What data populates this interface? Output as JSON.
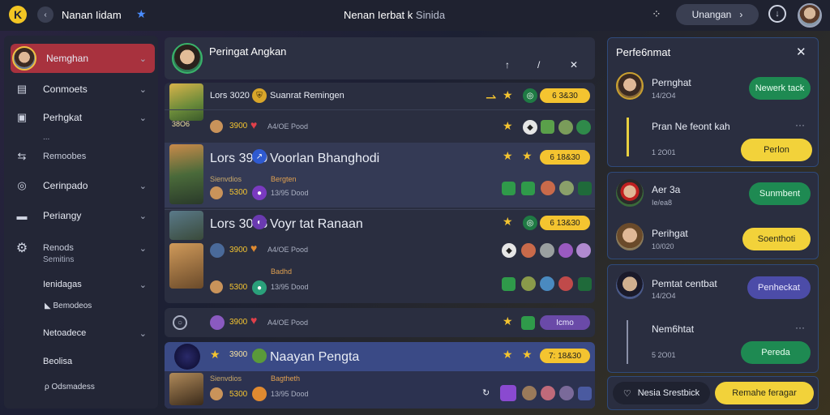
{
  "topbar": {
    "logo_glyph": "K",
    "back_glyph": "‹",
    "username": "Nanan Iidam",
    "star_glyph": "★",
    "title_main": "Nenan Ierbat k",
    "title_sub": "Sinida",
    "grid_glyph": "⁘",
    "search_label": "Unangan",
    "search_glyph": "›",
    "download_glyph": "↓"
  },
  "sidebar": {
    "items": [
      {
        "label": "Nemghan",
        "icon": "avatar",
        "active": true
      },
      {
        "label": "Conmoets",
        "icon": "layout-icon"
      },
      {
        "label": "Perhgkat",
        "icon": "lock-icon"
      },
      {
        "label": "Remoobes",
        "icon": "share-icon"
      },
      {
        "label": "Cerinpado",
        "icon": "target-icon"
      },
      {
        "label": "Periangy",
        "icon": "wallet-icon"
      },
      {
        "label": "Renods",
        "icon": "gear-icon"
      },
      {
        "label": "Ienidagas"
      },
      {
        "label": "Netoadece"
      },
      {
        "label": "Beolisa"
      }
    ],
    "sub_lines": [
      "...",
      "Semitins",
      "Bemodeos",
      "Odsmadess"
    ]
  },
  "main": {
    "header_title": "Peringat Angkan",
    "header_actions": [
      "↑",
      "/",
      "✕"
    ],
    "rows": [
      {
        "code": "Lors 3020",
        "name": "Suanrat Remingen",
        "pill": "6 3&30",
        "line2": "3900",
        "line2b": "A4/OE Pood",
        "badge": "38O6"
      },
      {
        "code": "Lors 3900",
        "name": "Voorlan Bhanghodi",
        "pill": "6 18&30",
        "line2": "5300",
        "line2b": "13/95 Dood",
        "sub_a": "Sienvdios",
        "sub_b": "Bergten"
      },
      {
        "code": "Lors 3036",
        "name": "Voyr tat Ranaan",
        "pill": "6 13&30",
        "line2": "3900",
        "line2b": "A4/OE Pood"
      },
      {
        "code": "",
        "name": "",
        "pill": "",
        "line2": "5300",
        "line2b": "13/95 Dood",
        "sub_a": "Sienvdios",
        "sub_b": "Badhd"
      },
      {
        "code": "",
        "name": "",
        "pill": "Icmo",
        "line2": "3900",
        "line2b": "A4/OE Pood"
      },
      {
        "code": "3900",
        "name": "Naayan Pengta",
        "pill": "7: 18&30",
        "line2": "5300",
        "line2b": "13/95 Dood",
        "sub_a": "Sienvdios",
        "sub_b": "Bagtheth"
      }
    ]
  },
  "right": {
    "title": "Perfe6nmat",
    "close_glyph": "✕",
    "entries": [
      {
        "name": "Pernghat",
        "sub": "14/2O4",
        "btn": "Newerk tack",
        "btn_style": "green"
      },
      {
        "name": "Pran Ne feont kah",
        "sub": "1 2O01",
        "btn": "Perlon",
        "btn_style": "yellow",
        "more": "···"
      },
      {
        "name": "Aer 3a",
        "sub": "Ie/ea8",
        "btn": "Sunmbent",
        "btn_style": "green"
      },
      {
        "name": "Perihgat",
        "sub": "10/020",
        "btn": "Soenthoti",
        "btn_style": "yellow"
      },
      {
        "name": "Pemtat centbat",
        "sub": "14/2O4",
        "btn": "Penheckat",
        "btn_style": "purple"
      },
      {
        "name": "Nem6htat",
        "sub": "5 2O01",
        "btn": "Pereda",
        "btn_style": "green",
        "more": "···"
      }
    ],
    "footer_left": "Nesia Srestbick",
    "footer_right": "Remahe feragar"
  }
}
